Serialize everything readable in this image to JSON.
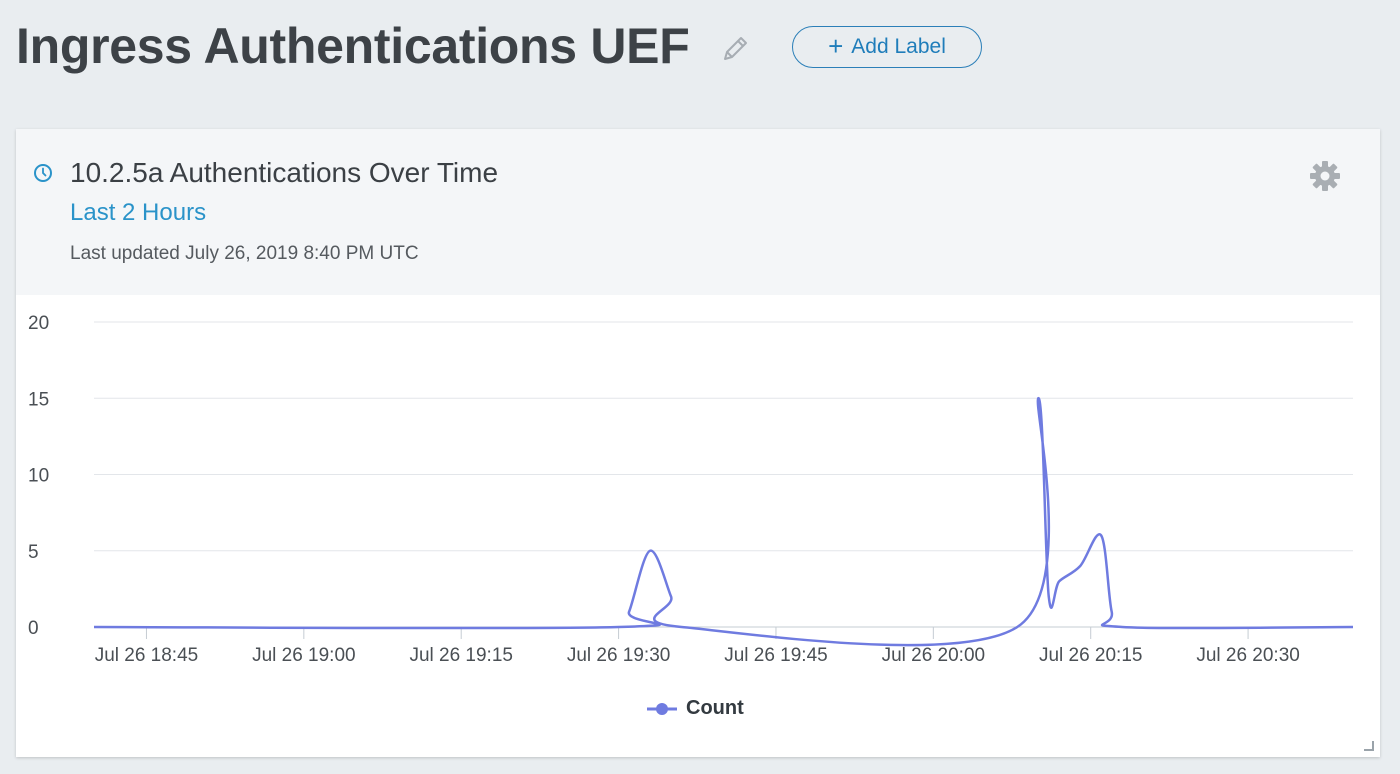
{
  "page": {
    "title": "Ingress Authentications UEF",
    "edit_icon": "pencil-icon",
    "add_label": "Add Label"
  },
  "widget": {
    "title": "10.2.5a Authentications Over Time",
    "time_range": "Last 2 Hours",
    "last_updated": "Last updated July 26, 2019 8:40 PM UTC",
    "icons": {
      "clock": "clock-icon",
      "settings": "gear-icon"
    }
  },
  "colors": {
    "background": "#e9edf0",
    "title": "#3d4247",
    "accent": "#2a93c9",
    "series": "#6f7be0",
    "grid": "#e3e6ea"
  },
  "chart_data": {
    "type": "line",
    "x_type": "time",
    "x_labels": [
      "Jul 26 18:45",
      "Jul 26 19:00",
      "Jul 26 19:15",
      "Jul 26 19:30",
      "Jul 26 19:45",
      "Jul 26 20:00",
      "Jul 26 20:15",
      "Jul 26 20:30"
    ],
    "xlim": [
      "Jul 26 18:40",
      "Jul 26 20:40"
    ],
    "ylim": [
      0,
      20
    ],
    "y_ticks": [
      0,
      5,
      10,
      15,
      20
    ],
    "grid": true,
    "legend": "bottom-center",
    "series": [
      {
        "name": "Count",
        "color": "#6f7be0",
        "points": [
          [
            "18:40",
            0
          ],
          [
            "19:30",
            0
          ],
          [
            "19:31",
            1
          ],
          [
            "19:33",
            5
          ],
          [
            "19:35",
            2
          ],
          [
            "19:36",
            0
          ],
          [
            "20:08",
            0
          ],
          [
            "20:10",
            15
          ],
          [
            "20:11",
            2
          ],
          [
            "20:12",
            3
          ],
          [
            "20:14",
            4
          ],
          [
            "20:16",
            6
          ],
          [
            "20:17",
            1
          ],
          [
            "20:18",
            0
          ],
          [
            "20:40",
            0
          ]
        ]
      }
    ]
  }
}
